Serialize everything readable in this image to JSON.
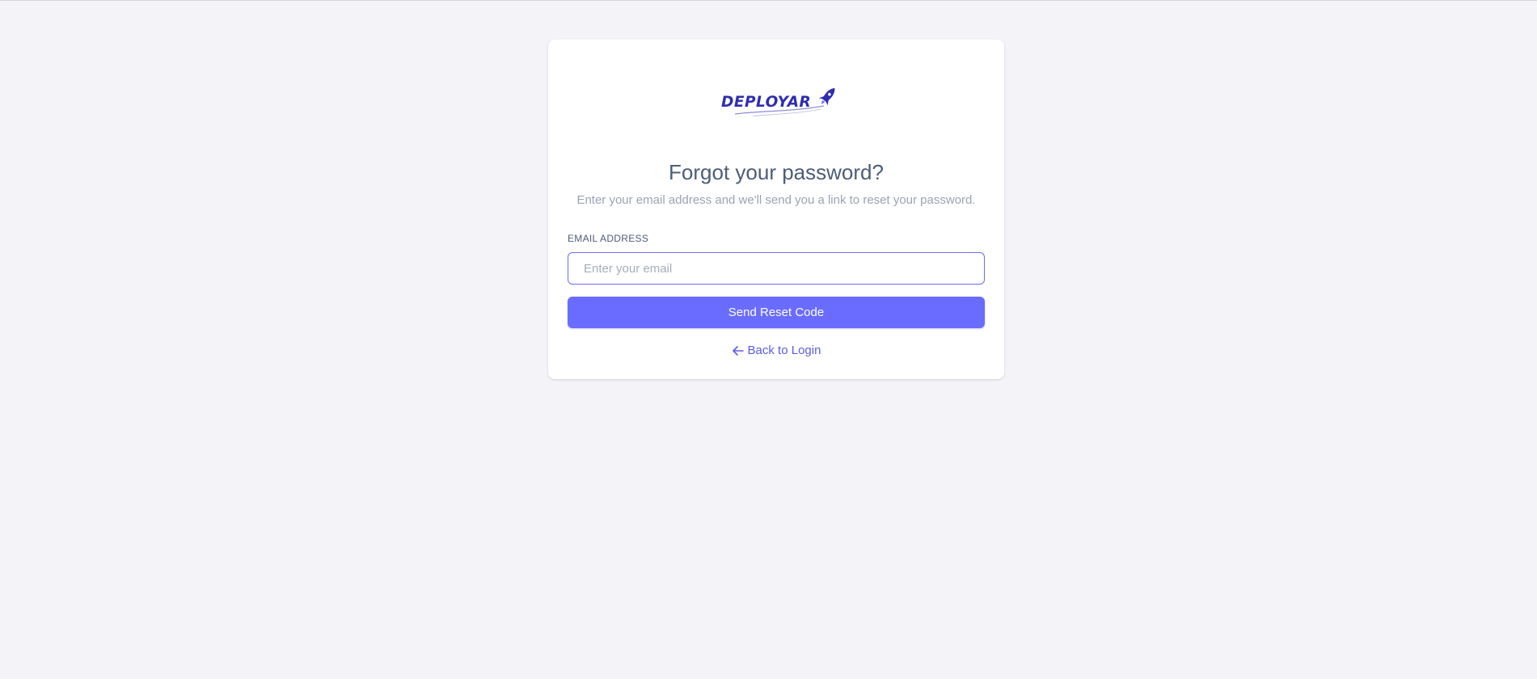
{
  "brand": {
    "logo_text": "DEPLOYAR",
    "logo_icon": "rocket-icon",
    "color": "#2f2db0"
  },
  "header": {
    "title": "Forgot your password?",
    "subtitle": "Enter your email address and we'll send you a link to reset your password."
  },
  "form": {
    "email_label": "EMAIL ADDRESS",
    "email_placeholder": "Enter your email",
    "email_value": "",
    "submit_label": "Send Reset Code",
    "accent_color": "#6a6cff"
  },
  "footer": {
    "back_icon": "arrow-left-icon",
    "back_label": "Back to Login"
  }
}
